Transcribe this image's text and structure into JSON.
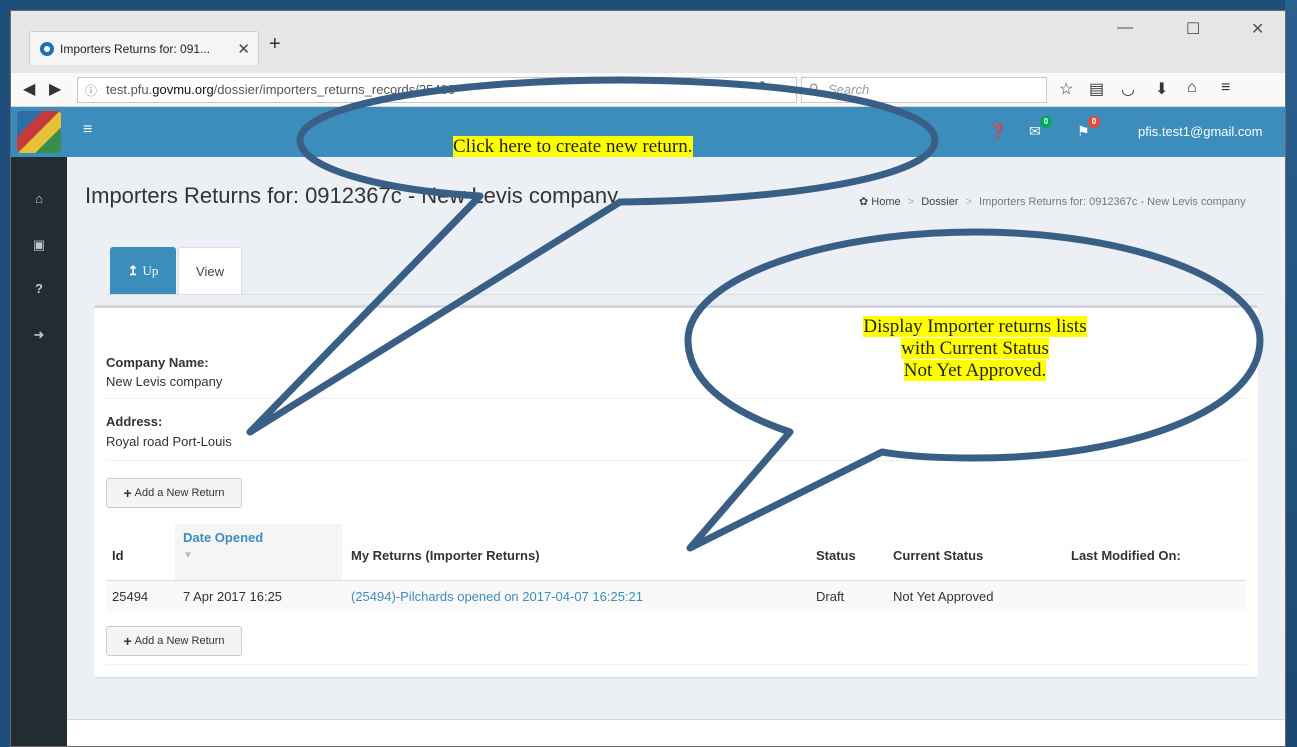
{
  "browser": {
    "tab_title": "Importers Returns for: 091...",
    "url_prefix": "test.pfu.",
    "url_domain": "govmu.org",
    "url_path": "/dossier/importers_returns_records/25406",
    "search_placeholder": "Search"
  },
  "header": {
    "user_email": "pfis.test1@gmail.com",
    "mail_badge": "0",
    "flag_badge": "0",
    "colors": {
      "bar": "#3c8dbc",
      "sidebar": "#222d32",
      "mail_badge": "#00a65a",
      "flag_badge": "#dd4b39"
    }
  },
  "page": {
    "title": "Importers Returns for: 0912367c - New Levis company",
    "breadcrumb": [
      "Home",
      "Dossier",
      "Importers Returns for: 0912367c - New Levis company"
    ],
    "tabs": {
      "up": "Up",
      "view": "View"
    }
  },
  "details": {
    "company_label": "Company Name:",
    "company_value": "New Levis company",
    "address_label": "Address:",
    "address_value": "Royal road Port-Louis",
    "add_button": "Add a New Return"
  },
  "table": {
    "columns": [
      "Id",
      "Date Opened",
      "My Returns (Importer Returns)",
      "Status",
      "Current Status",
      "Last Modified On:"
    ],
    "rows": [
      {
        "id": "25494",
        "date_opened": "7 Apr 2017 16:25",
        "return": "(25494)-Pilchards opened on 2017-04-07 16:25:21",
        "status": "Draft",
        "current_status": "Not Yet Approved",
        "last_modified": ""
      }
    ]
  },
  "annotations": {
    "callout1": "Click here to create new return.",
    "callout2_line1": "Display Importer returns lists",
    "callout2_line2": "with Current Status",
    "callout2_line3": "Not Yet Approved."
  }
}
